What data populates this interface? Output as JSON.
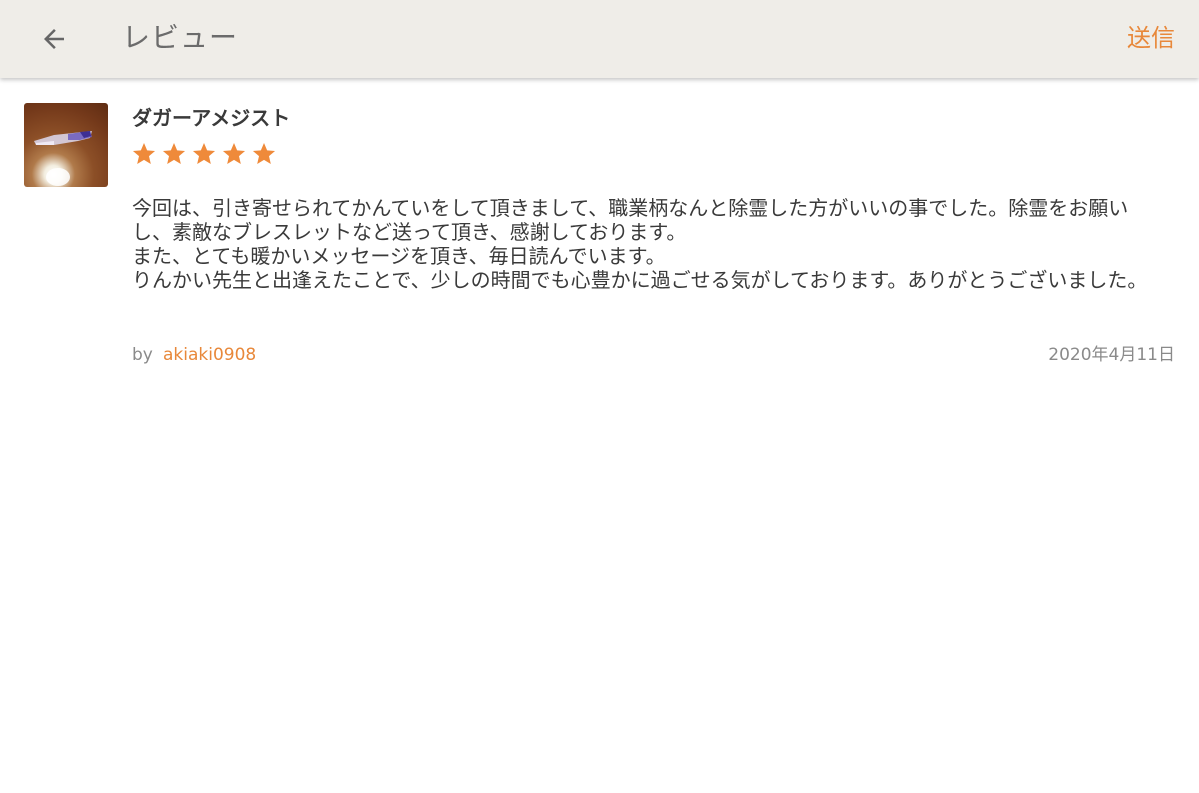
{
  "appbar": {
    "back_icon": "arrow-left-icon",
    "title": "レビュー",
    "send_label": "送信"
  },
  "review": {
    "thumbnail_icon": "amethyst-photo",
    "item_title": "ダガーアメジスト",
    "rating": 5,
    "rating_max": 5,
    "body_lines": [
      "今回は、引き寄せられてかんていをして頂きまして、職業柄なんと除霊した方がいいの事でした。除霊をお願いし、素敵なブレスレットなど送って頂き、感謝しております。",
      "また、とても暖かいメッセージを頂き、毎日読んでいます。",
      "りんかい先生と出逢えたことで、少しの時間でも心豊かに過ごせる気がしております。ありがとうございました。"
    ],
    "by_label": "by",
    "username": "akiaki0908",
    "date": "2020年4月11日"
  },
  "colors": {
    "accent": "#e8883a",
    "appbar_bg": "#efede8",
    "text": "#3a3a3a",
    "muted": "#8a8a8a",
    "star": "#ef8a3a"
  }
}
